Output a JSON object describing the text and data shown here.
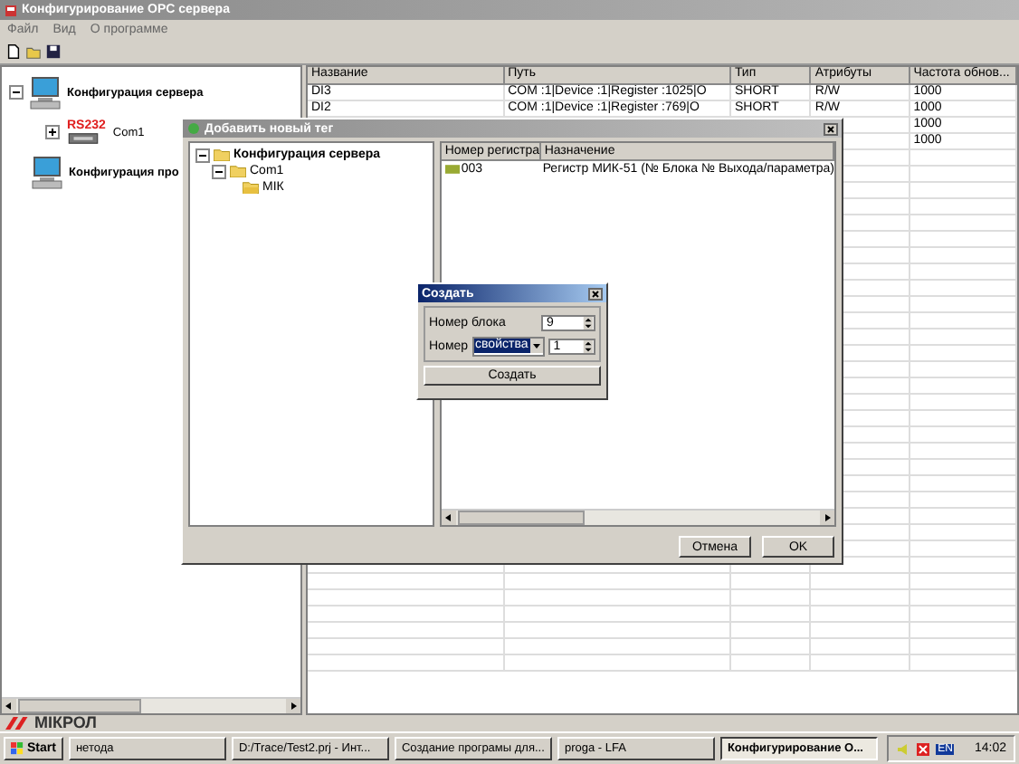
{
  "window": {
    "title": "Конфигурирование OPC сервера"
  },
  "menu": [
    "Файл",
    "Вид",
    "О программе"
  ],
  "tree": [
    {
      "label": "Конфигурация сервера",
      "kind": "server",
      "expanded": true,
      "children": [
        {
          "label": "Com1",
          "badge": "RS232",
          "kind": "port",
          "expanded": false
        }
      ]
    },
    {
      "label": "Конфигурация про",
      "kind": "server"
    }
  ],
  "table": {
    "columns": [
      "Название",
      "Путь",
      "Тип",
      "Атрибуты",
      "Частота обнов..."
    ],
    "rows": [
      {
        "cells": [
          "DI3",
          "COM :1|Device :1|Register :1025|O",
          "SHORT",
          "R/W",
          "1000"
        ]
      },
      {
        "cells": [
          "DI2",
          "COM :1|Device :1|Register :769|O",
          "SHORT",
          "R/W",
          "1000"
        ]
      },
      {
        "cells": [
          null,
          null,
          null,
          null,
          "1000"
        ]
      },
      {
        "cells": [
          null,
          null,
          null,
          null,
          "1000"
        ]
      }
    ]
  },
  "add_tag_dialog": {
    "title": "Добавить новый тег",
    "tree": [
      {
        "label": "Конфигурация сервера",
        "expanded": true,
        "children": [
          {
            "label": "Com1",
            "expanded": true,
            "children": [
              {
                "label": "МІК"
              }
            ]
          }
        ]
      }
    ],
    "columns": [
      "Номер регистра",
      "Назначение"
    ],
    "rows": [
      {
        "register": "003",
        "purpose": "Регистр МИК-51 (№ Блока № Выхода/параметра)"
      }
    ],
    "buttons": [
      "Отмена",
      "OK"
    ]
  },
  "create_dialog": {
    "title": "Создать",
    "block_label": "Номер блока",
    "block_value": "9",
    "number_label": "Номер",
    "number_kind": "свойства",
    "number_value": "1",
    "button": "Создать"
  },
  "logo": "МІКРОЛ",
  "taskbar": {
    "start": "Start",
    "tasks": [
      {
        "label": "нетода",
        "selected": false
      },
      {
        "label": "D:/Trace/Test2.prj - Инт...",
        "selected": false
      },
      {
        "label": "Создание програмы для...",
        "selected": false
      },
      {
        "label": "proga - LFA",
        "selected": false
      },
      {
        "label": "Конфигурирование О...",
        "selected": true
      }
    ],
    "language": "EN",
    "clock": "14:02"
  }
}
